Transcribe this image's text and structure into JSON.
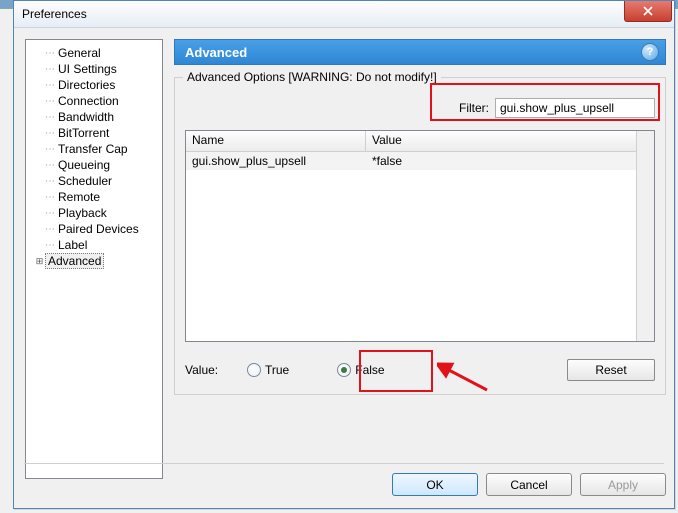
{
  "window": {
    "title": "Preferences",
    "close_icon": "close"
  },
  "tree": {
    "items": [
      {
        "label": "General"
      },
      {
        "label": "UI Settings"
      },
      {
        "label": "Directories"
      },
      {
        "label": "Connection"
      },
      {
        "label": "Bandwidth"
      },
      {
        "label": "BitTorrent"
      },
      {
        "label": "Transfer Cap"
      },
      {
        "label": "Queueing"
      },
      {
        "label": "Scheduler"
      },
      {
        "label": "Remote"
      },
      {
        "label": "Playback"
      },
      {
        "label": "Paired Devices"
      },
      {
        "label": "Label"
      },
      {
        "label": "Advanced",
        "selected": true,
        "expandable": true
      }
    ]
  },
  "panel": {
    "header": "Advanced",
    "help_icon": "?",
    "group_legend": "Advanced Options [WARNING: Do not modify!]",
    "filter_label": "Filter:",
    "filter_value": "gui.show_plus_upsell",
    "columns": {
      "name": "Name",
      "value": "Value"
    },
    "rows": [
      {
        "name": "gui.show_plus_upsell",
        "value": "*false"
      }
    ],
    "value_label": "Value:",
    "radio_true": "True",
    "radio_false": "False",
    "selected_radio": "false",
    "reset": "Reset"
  },
  "buttons": {
    "ok": "OK",
    "cancel": "Cancel",
    "apply": "Apply"
  }
}
